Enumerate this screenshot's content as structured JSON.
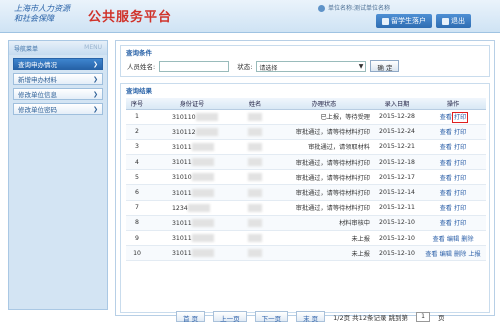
{
  "header": {
    "logo_line1": "上海市人力资源",
    "logo_line2": "和社会保障",
    "title": "公共服务平台",
    "user_info": "单位名称:测试单位名称",
    "buttons": [
      {
        "label": "留学生落户"
      },
      {
        "label": "退出"
      }
    ]
  },
  "sidebar": {
    "title": "导航菜单",
    "menu_label": "MENU",
    "items": [
      {
        "label": "查询申办情况"
      },
      {
        "label": "新增申办材料"
      },
      {
        "label": "修改单位信息"
      },
      {
        "label": "修改单位密码"
      }
    ]
  },
  "query": {
    "legend": "查询条件",
    "name_label": "人员姓名:",
    "status_label": "状态:",
    "status_value": "请选择",
    "confirm_label": "确 定"
  },
  "results": {
    "legend": "查询结果",
    "columns": [
      "序号",
      "身份证号",
      "姓名",
      "办理状态",
      "录入日期",
      "操作"
    ],
    "rows": [
      {
        "no": "1",
        "id": "310110",
        "status": "已上报，等待受理",
        "date": "2015-12-28",
        "ops": [
          "查看",
          "打印"
        ]
      },
      {
        "no": "2",
        "id": "310112",
        "status": "审批通过，请等待材料打印",
        "date": "2015-12-24",
        "ops": [
          "查看",
          "打印"
        ]
      },
      {
        "no": "3",
        "id": "31011",
        "status": "审批通过，请领取材料",
        "date": "2015-12-21",
        "ops": [
          "查看",
          "打印"
        ]
      },
      {
        "no": "4",
        "id": "31011",
        "status": "审批通过，请等待材料打印",
        "date": "2015-12-18",
        "ops": [
          "查看",
          "打印"
        ]
      },
      {
        "no": "5",
        "id": "31010",
        "status": "审批通过，请等待材料打印",
        "date": "2015-12-17",
        "ops": [
          "查看",
          "打印"
        ]
      },
      {
        "no": "6",
        "id": "31011",
        "status": "审批通过，请等待材料打印",
        "date": "2015-12-14",
        "ops": [
          "查看",
          "打印"
        ]
      },
      {
        "no": "7",
        "id": "1234",
        "status": "审批通过，请等待材料打印",
        "date": "2015-12-11",
        "ops": [
          "查看",
          "打印"
        ]
      },
      {
        "no": "8",
        "id": "31011",
        "status": "材料审核中",
        "date": "2015-12-10",
        "ops": [
          "查看",
          "打印"
        ]
      },
      {
        "no": "9",
        "id": "31011",
        "status": "未上报",
        "date": "2015-12-10",
        "ops": [
          "查看",
          "编辑",
          "删除"
        ]
      },
      {
        "no": "10",
        "id": "31011",
        "status": "未上报",
        "date": "2015-12-10",
        "ops": [
          "查看",
          "编辑",
          "删除",
          "上报"
        ]
      }
    ]
  },
  "pager": {
    "first": "首 页",
    "prev": "上一页",
    "next": "下一页",
    "last": "末 页",
    "info": "1/2页 共12条记录 跳到第",
    "page_value": "1",
    "page_suffix": "页"
  }
}
